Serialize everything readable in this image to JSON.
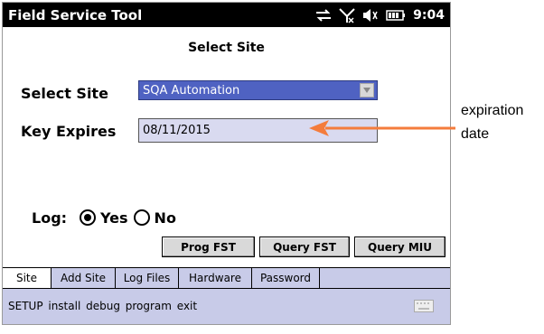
{
  "app": {
    "title": "Field Service Tool",
    "clock": "9:04",
    "page_title": "Select Site"
  },
  "form": {
    "site_label": "Select Site",
    "site_value": "SQA Automation",
    "key_label": "Key Expires",
    "key_value": "08/11/2015",
    "log_label": "Log:",
    "log_options": [
      "Yes",
      "No"
    ],
    "log_selected": "Yes"
  },
  "buttons": {
    "prog": "Prog FST",
    "query_fst": "Query FST",
    "query_miu": "Query MIU"
  },
  "tabs": [
    "Site",
    "Add Site",
    "Log Files",
    "Hardware",
    "Password"
  ],
  "menu": "SETUP install debug program exit",
  "annotation": {
    "line1": "expiration",
    "line2": "date"
  },
  "colors": {
    "arrow": "#f47c3c",
    "selection": "#4f62c2",
    "panel": "#c8cbe8"
  },
  "icons": [
    "sync-icon",
    "no-signal-icon",
    "volume-icon",
    "battery-icon",
    "dropdown-arrow-icon",
    "keyboard-icon"
  ]
}
